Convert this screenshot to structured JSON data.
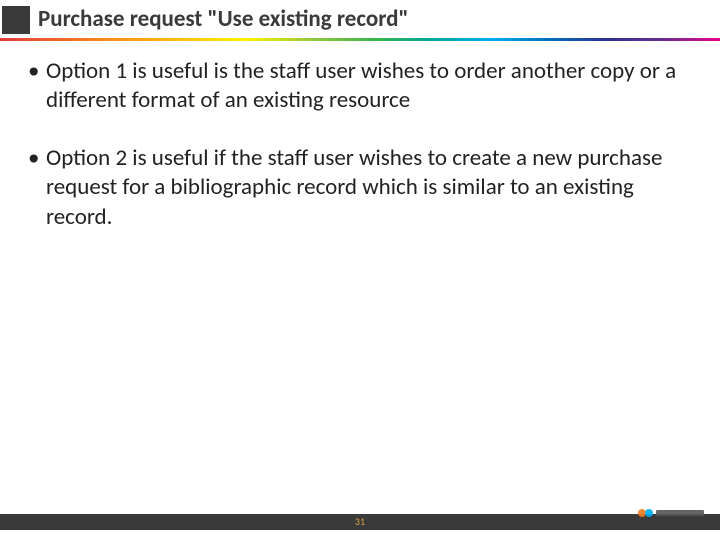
{
  "header": {
    "title": "Purchase request \"Use existing record\""
  },
  "body": {
    "bullets": [
      "Option 1 is useful is the staff user wishes to order another copy or a different format of an existing resource",
      "Option 2 is useful if the staff user wishes to create a new purchase request for a bibliographic record which is similar to an existing record."
    ]
  },
  "footer": {
    "page_number": "31"
  }
}
